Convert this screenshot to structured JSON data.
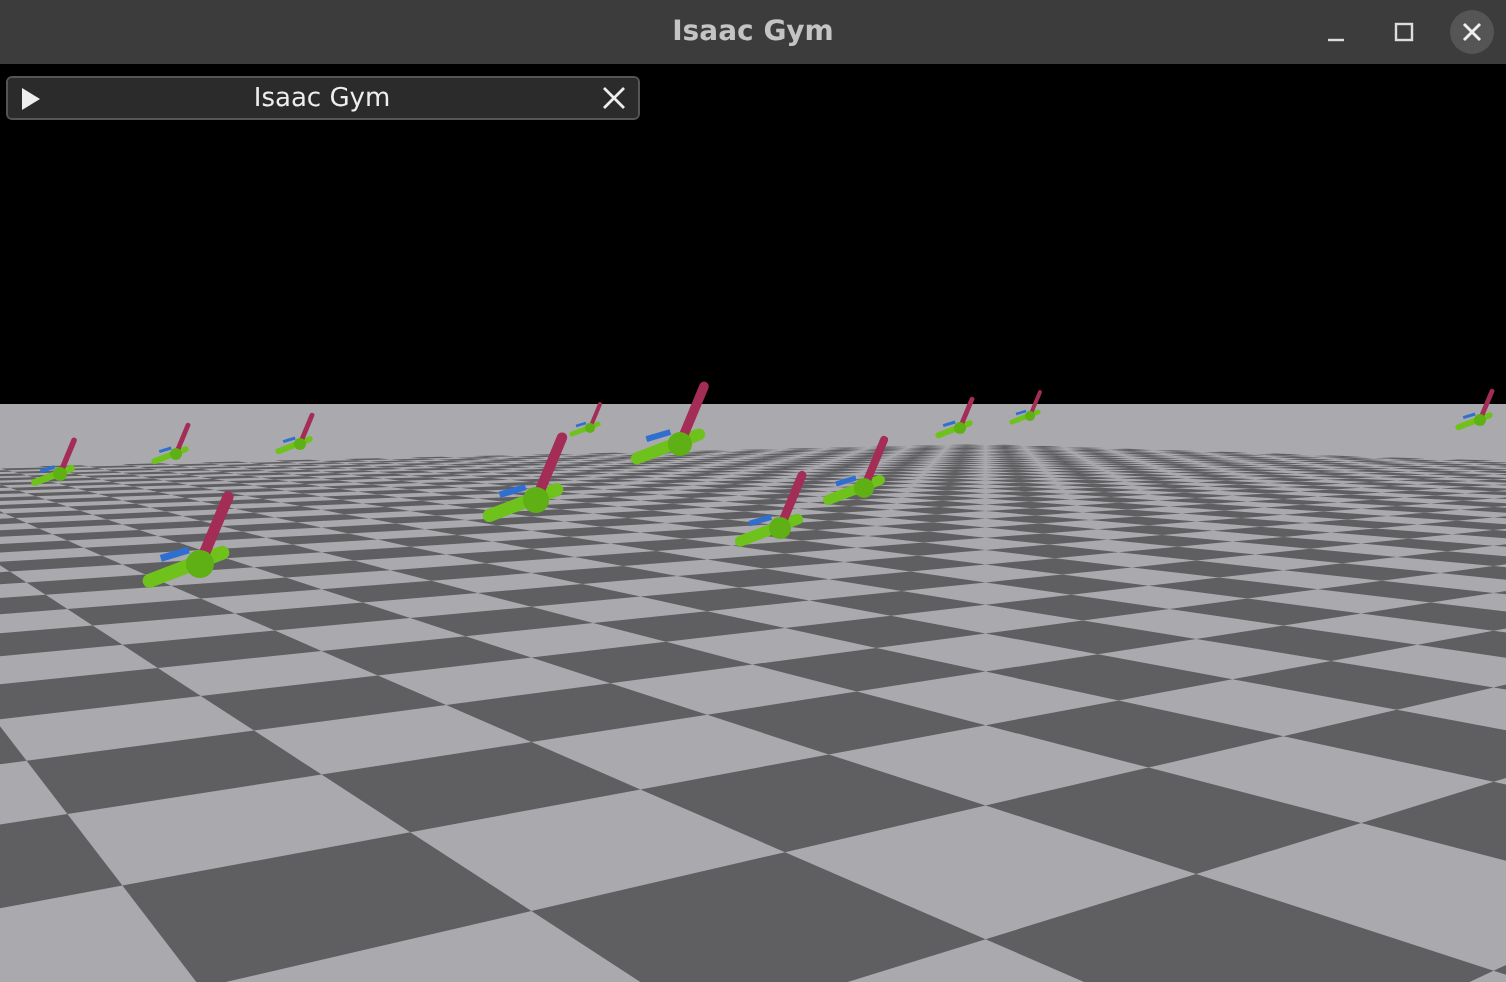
{
  "window": {
    "title": "Isaac Gym"
  },
  "viewer_panel": {
    "title": "Isaac Gym",
    "expanded": false
  }
}
